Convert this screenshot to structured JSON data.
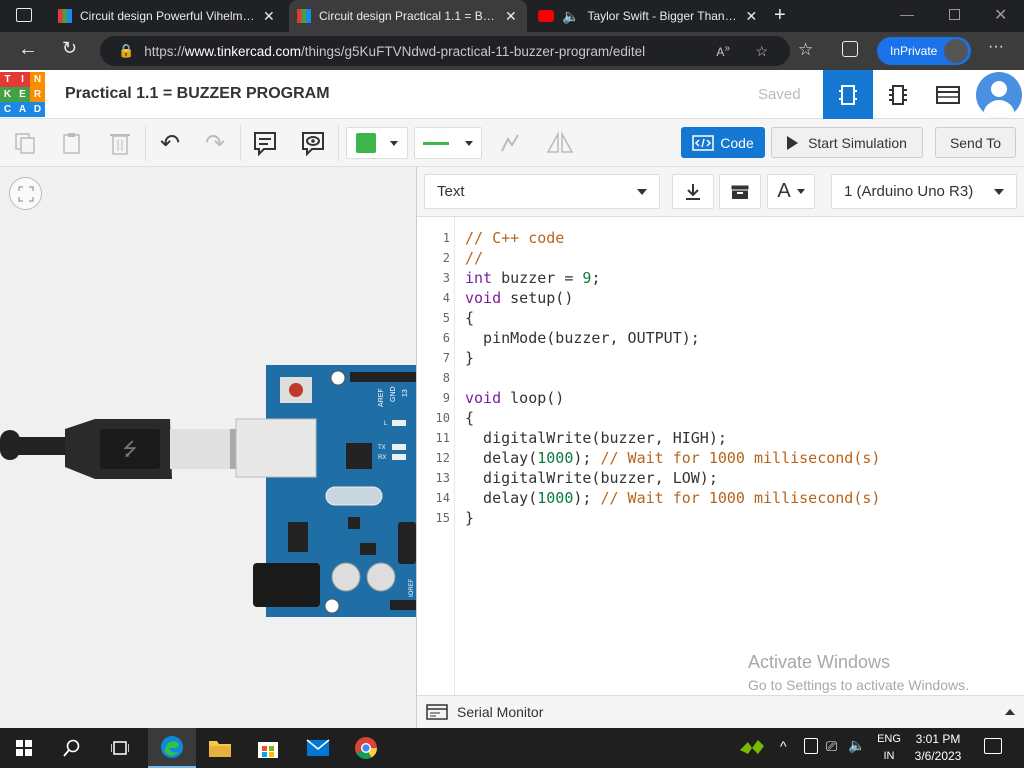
{
  "browser": {
    "tabs": [
      {
        "title": "Circuit design Powerful Vihelmo |",
        "active": false
      },
      {
        "title": "Circuit design Practical 1.1 = BUZ",
        "active": true
      },
      {
        "title": "Taylor Swift - Bigger Than Th",
        "active": false
      }
    ],
    "url_prefix": "https://",
    "url_domain": "www.tinkercad.com",
    "url_path": "/things/g5KuFTVNdwd-practical-11-buzzer-program/editel",
    "inprivate_label": "InPrivate"
  },
  "tinkercad": {
    "logo_letters": [
      "T",
      "I",
      "N",
      "K",
      "E",
      "R",
      "C",
      "A",
      "D"
    ],
    "design_title": "Practical 1.1 = BUZZER PROGRAM",
    "save_status": "Saved",
    "code_button": "Code",
    "start_simulation_button": "Start Simulation",
    "send_to_button": "Send To"
  },
  "code_panel": {
    "mode_select": "Text",
    "board_select": "1 (Arduino Uno R3)",
    "serial_monitor": "Serial Monitor",
    "lines": [
      {
        "n": "1",
        "text": "// C++ code"
      },
      {
        "n": "2",
        "text": "//"
      },
      {
        "n": "3",
        "text": "int buzzer = 9;"
      },
      {
        "n": "4",
        "text": "void setup()"
      },
      {
        "n": "5",
        "text": "{"
      },
      {
        "n": "6",
        "text": "  pinMode(buzzer, OUTPUT);"
      },
      {
        "n": "7",
        "text": "}"
      },
      {
        "n": "8",
        "text": ""
      },
      {
        "n": "9",
        "text": "void loop()"
      },
      {
        "n": "10",
        "text": "{"
      },
      {
        "n": "11",
        "text": "  digitalWrite(buzzer, HIGH);"
      },
      {
        "n": "12",
        "text": "  delay(1000); // Wait for 1000 millisecond(s)"
      },
      {
        "n": "13",
        "text": "  digitalWrite(buzzer, LOW);"
      },
      {
        "n": "14",
        "text": "  delay(1000); // Wait for 1000 millisecond(s)"
      },
      {
        "n": "15",
        "text": "}"
      }
    ]
  },
  "board": {
    "labels": [
      "AREF",
      "GND",
      "13",
      "L",
      "TX",
      "RX",
      "IOREF"
    ]
  },
  "watermark": {
    "line1": "Activate Windows",
    "line2": "Go to Settings to activate Windows."
  },
  "taskbar": {
    "lang_top": "ENG",
    "lang_bottom": "IN",
    "time": "3:01 PM",
    "date": "3/6/2023"
  },
  "colors": {
    "accent": "#1477d1",
    "browser_dark": "#202124",
    "comment": "#b8651b",
    "keyword": "#7a1fa2",
    "number": "#0b7a3e"
  }
}
